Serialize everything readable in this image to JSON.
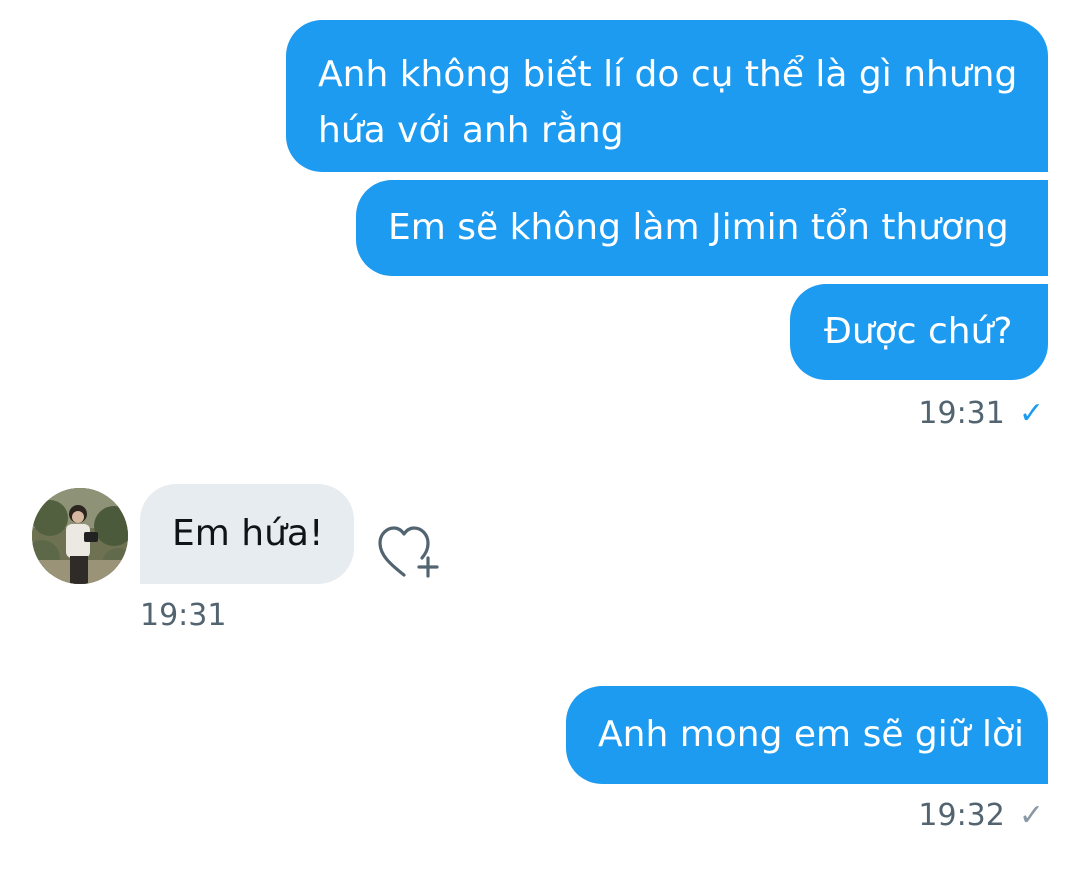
{
  "colors": {
    "outgoing_bubble": "#1d9bf0",
    "incoming_bubble": "#e7ecf0",
    "timestamp_text": "#536471",
    "read_check": "#1d9bf0",
    "sent_check": "#8b98a5"
  },
  "messages": [
    {
      "direction": "outgoing",
      "text": "Anh không biết lí do cụ thể là gì nhưng hứa với anh rằng"
    },
    {
      "direction": "outgoing",
      "text": "Em sẽ không làm Jimin tổn thương"
    },
    {
      "direction": "outgoing",
      "text": "Được chứ?"
    },
    {
      "direction": "incoming",
      "text": "Em hứa!"
    },
    {
      "direction": "outgoing",
      "text": "Anh mong em sẽ giữ lời"
    }
  ],
  "timestamps": {
    "group1": "19:31",
    "incoming": "19:31",
    "last": "19:32"
  },
  "icons": {
    "group1_status": "read-check-icon",
    "last_status": "sent-check-icon",
    "reaction": "heart-plus-icon",
    "check_glyph": "✓"
  }
}
